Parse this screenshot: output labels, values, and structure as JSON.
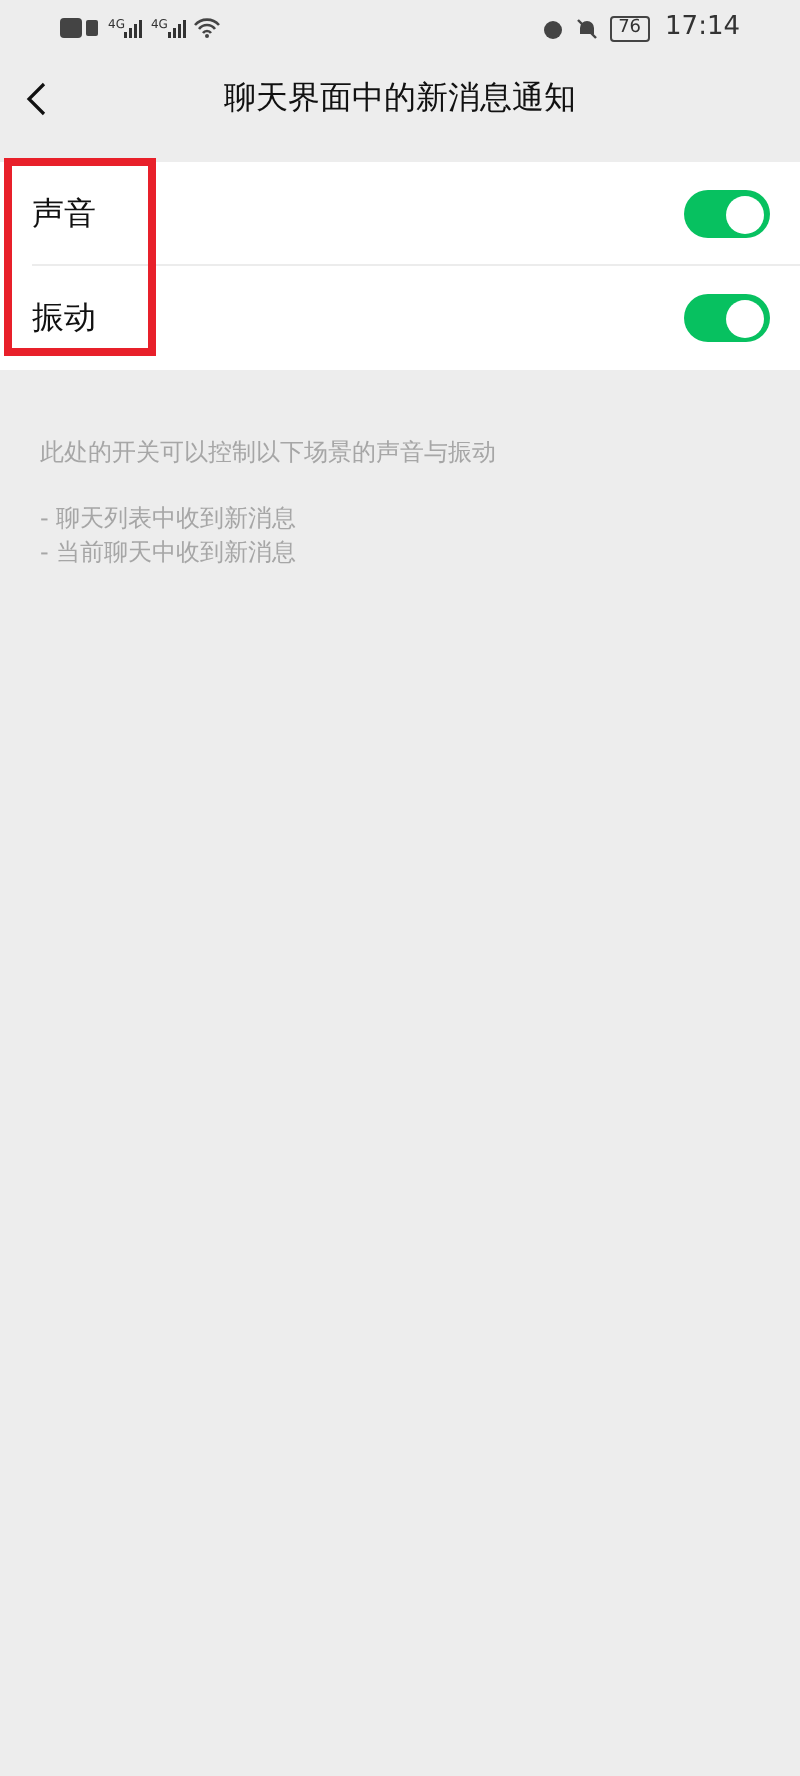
{
  "status_bar": {
    "network_labels": [
      "4G",
      "4G"
    ],
    "battery": "76",
    "time": "17:14"
  },
  "nav": {
    "title": "聊天界面中的新消息通知"
  },
  "settings": [
    {
      "label": "声音",
      "on": true
    },
    {
      "label": "振动",
      "on": true
    }
  ],
  "annotation": {
    "highlighted": true
  },
  "hint": {
    "text": "此处的开关可以控制以下场景的声音与振动",
    "items": [
      "- 聊天列表中收到新消息",
      "- 当前聊天中收到新消息"
    ]
  }
}
